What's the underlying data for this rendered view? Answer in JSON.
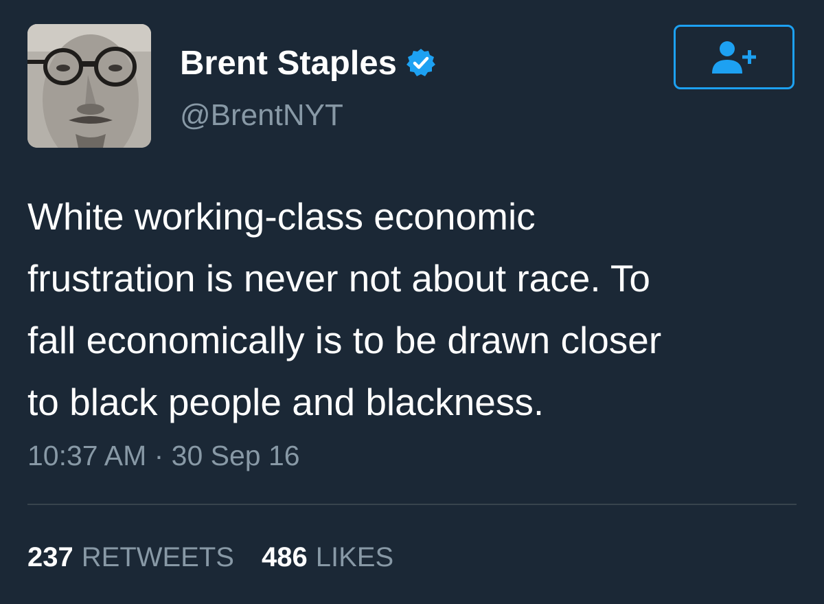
{
  "user": {
    "display_name": "Brent Staples",
    "handle": "@BrentNYT",
    "verified": true
  },
  "icons": {
    "avatar": "profile-photo",
    "verified": "verified-badge-icon",
    "follow": "add-user-icon"
  },
  "tweet": {
    "text": "White working-class economic\nfrustration is never not about race. To\nfall economically is to be drawn closer\nto black people and blackness.",
    "timestamp": "10:37 AM · 30 Sep 16"
  },
  "stats": {
    "retweets_count": "237",
    "retweets_label": "RETWEETS",
    "likes_count": "486",
    "likes_label": "LIKES"
  },
  "colors": {
    "background": "#1b2836",
    "accent": "#1da1f2",
    "secondary_text": "#8899a6",
    "divider": "#38444d"
  }
}
